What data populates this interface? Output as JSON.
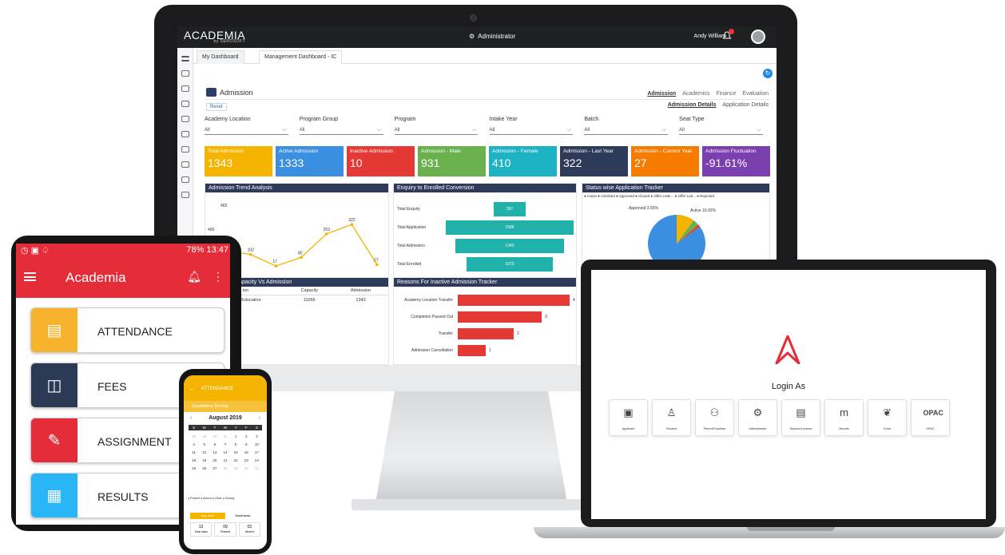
{
  "imac": {
    "logo": "ACADEMIA",
    "logo_sub": "by SEROSOFT",
    "role": "Administrator",
    "user_name": "Andy William",
    "notification_count": "9",
    "tabs": [
      "My Dashboard",
      "Management Dashboard - IC"
    ],
    "section_title": "Admission",
    "reset_label": "Reset",
    "nav_links": [
      "Admission",
      "Academics",
      "Finance",
      "Evaluation"
    ],
    "sub_links": [
      "Admission Details",
      "Application Details"
    ],
    "filters": [
      {
        "label": "Academy Location",
        "value": "All"
      },
      {
        "label": "Program Group",
        "value": "All"
      },
      {
        "label": "Program",
        "value": "All"
      },
      {
        "label": "Intake Year",
        "value": "All"
      },
      {
        "label": "Batch",
        "value": "All"
      },
      {
        "label": "Seat Type",
        "value": "All"
      }
    ],
    "stats": [
      {
        "label": "Total Admission",
        "value": "1343",
        "color": "#f4b400"
      },
      {
        "label": "Active Admission",
        "value": "1333",
        "color": "#3b8fe0"
      },
      {
        "label": "Inactive Admission",
        "value": "10",
        "color": "#e53935"
      },
      {
        "label": "Admission - Male",
        "value": "931",
        "color": "#6ab04c"
      },
      {
        "label": "Admission - Female",
        "value": "410",
        "color": "#1eb3c4"
      },
      {
        "label": "Admission - Last Year",
        "value": "322",
        "color": "#2e3a59"
      },
      {
        "label": "Admission - Current Year",
        "value": "27",
        "color": "#f57c00"
      },
      {
        "label": "Admission Fluctuation",
        "value": "-91.61%",
        "color": "#7b3fb0"
      }
    ],
    "panels": {
      "trend": "Admission Trend Analysis",
      "conversion": "Enquiry to Enrolled Conversion",
      "status": "Status wise Application Tracker",
      "capacity": "ation wise Capacity Vs Admission",
      "reasons": "Reasons For Inactive Admission Tracker"
    },
    "status_legend": "● Active  ● Admitted  ● Approved  ● Closed  ● Offer Lette...  ● Offer Lett...  ● Rejected",
    "pie_labels": {
      "approved": "Approved 3.55%",
      "active": "Active 10.02%"
    },
    "capacity_table": {
      "headers": [
        "ion",
        "Capacity",
        "Admission"
      ],
      "rows": [
        [
          "cious Education",
          "11066",
          "1343"
        ]
      ]
    }
  },
  "chart_data": [
    {
      "type": "line",
      "title": "Admission Trend Analysis",
      "x": [
        "2018",
        "2019",
        "2020",
        "2021",
        "2022",
        "2023",
        "2024"
      ],
      "y_tick_label": "400",
      "series": [
        {
          "values": [
            131,
            102,
            17,
            80,
            253,
            322,
            27
          ]
        }
      ],
      "extra_label": "465"
    },
    {
      "type": "bar",
      "title": "Enquiry to Enrolled Conversion",
      "categories": [
        "Total Enquiry",
        "Total Application",
        "Total Admission",
        "Total Enrolled"
      ],
      "values": [
        397,
        1589,
        1343,
        1073
      ]
    },
    {
      "type": "pie",
      "title": "Status wise Application Tracker",
      "slices": [
        {
          "name": "Active",
          "value": 10.02,
          "color": "#f4b400"
        },
        {
          "name": "Approved",
          "value": 3.55,
          "color": "#6ab04c"
        },
        {
          "name": "Rejected",
          "value": 1.5,
          "color": "#e53935"
        },
        {
          "name": "Other",
          "value": 84.93,
          "color": "#3b8fe0"
        }
      ]
    },
    {
      "type": "bar",
      "title": "Reasons For Inactive Admission Tracker",
      "categories": [
        "Academy Location Transfer",
        "Completion Passed Out",
        "Transfer",
        "Admission Cancellation"
      ],
      "values": [
        4,
        3,
        2,
        1
      ]
    }
  ],
  "tablet": {
    "status_right": "78% 13:47",
    "app_title": "Academia",
    "cards": [
      {
        "label": "ATTENDANCE",
        "color": "#f6b32b"
      },
      {
        "label": "FEES",
        "color": "#2b3a55"
      },
      {
        "label": "ASSIGNMENT",
        "color": "#e52d3a"
      },
      {
        "label": "RESULTS",
        "color": "#29b6f6"
      }
    ]
  },
  "phone": {
    "title": "ATTENDANCE",
    "banner": "Quantitative Techniq...",
    "month": "August 2019",
    "day_headers": [
      "S",
      "M",
      "T",
      "W",
      "T",
      "F",
      "S"
    ],
    "days": [
      "28",
      "29",
      "30",
      "31",
      "1",
      "2",
      "3",
      "4",
      "5",
      "6",
      "7",
      "8",
      "9",
      "10",
      "11",
      "12",
      "13",
      "14",
      "15",
      "16",
      "17",
      "18",
      "19",
      "20",
      "21",
      "22",
      "23",
      "24",
      "25",
      "26",
      "27",
      "28",
      "29",
      "30",
      "31"
    ],
    "legend": "● Present  ● Absent  ● Other  ● Holiday",
    "tabs": [
      "Day wise",
      "Monthwise"
    ],
    "counts": [
      {
        "n": "12",
        "l": "Total class"
      },
      {
        "n": "09",
        "l": "Present"
      },
      {
        "n": "03",
        "l": "Absent"
      }
    ]
  },
  "laptop": {
    "login_title": "Login As",
    "roles": [
      {
        "name": "Applicant",
        "icon": "▣"
      },
      {
        "name": "Student",
        "icon": "♙"
      },
      {
        "name": "Parent/Guardian",
        "icon": "⚇"
      },
      {
        "name": "Administrator",
        "icon": "⚙"
      },
      {
        "name": "Teacher/Lecturer",
        "icon": "▤"
      },
      {
        "name": "Moodle",
        "icon": "m"
      },
      {
        "name": "Koha",
        "icon": "❦"
      },
      {
        "name": "OPAC",
        "icon": "OPAC"
      }
    ]
  }
}
